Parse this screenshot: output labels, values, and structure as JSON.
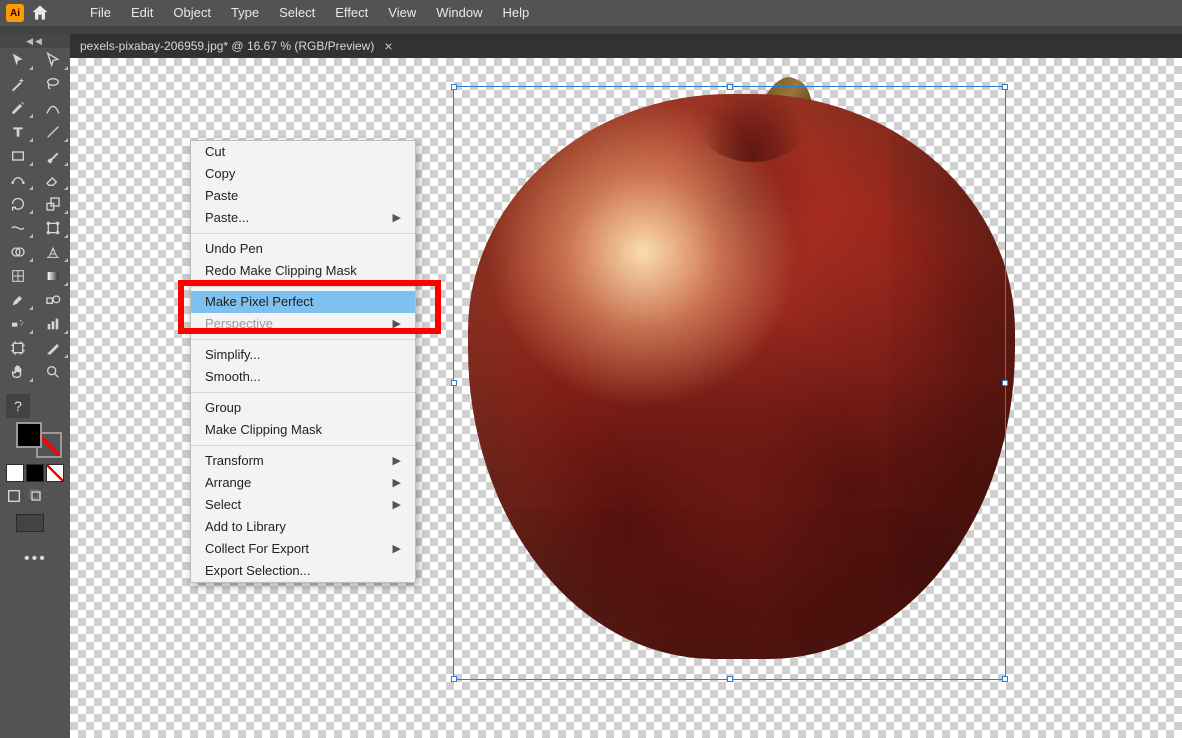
{
  "app_logo_text": "Ai",
  "menubar": [
    "File",
    "Edit",
    "Object",
    "Type",
    "Select",
    "Effect",
    "View",
    "Window",
    "Help"
  ],
  "document_tab": {
    "title": "pexels-pixabay-206959.jpg* @ 16.67 % (RGB/Preview)",
    "close_glyph": "×"
  },
  "tools_question_mark": "?",
  "tools_more_glyph": "•••",
  "context_menu": {
    "items": [
      {
        "label": "Cut"
      },
      {
        "label": "Copy"
      },
      {
        "label": "Paste"
      },
      {
        "label": "Paste...",
        "sub": true
      },
      {
        "sep": true
      },
      {
        "label": "Undo Pen"
      },
      {
        "label": "Redo Make Clipping Mask"
      },
      {
        "sep": true
      },
      {
        "label": "Make Pixel Perfect",
        "hl": true
      },
      {
        "label": "Perspective",
        "disabled": true,
        "sub": true
      },
      {
        "sep": true
      },
      {
        "label": "Simplify..."
      },
      {
        "label": "Smooth..."
      },
      {
        "sep": true
      },
      {
        "label": "Group"
      },
      {
        "label": "Make Clipping Mask"
      },
      {
        "sep": true
      },
      {
        "label": "Transform",
        "sub": true
      },
      {
        "label": "Arrange",
        "sub": true
      },
      {
        "label": "Select",
        "sub": true
      },
      {
        "label": "Add to Library"
      },
      {
        "label": "Collect For Export",
        "sub": true
      },
      {
        "label": "Export Selection..."
      }
    ]
  }
}
